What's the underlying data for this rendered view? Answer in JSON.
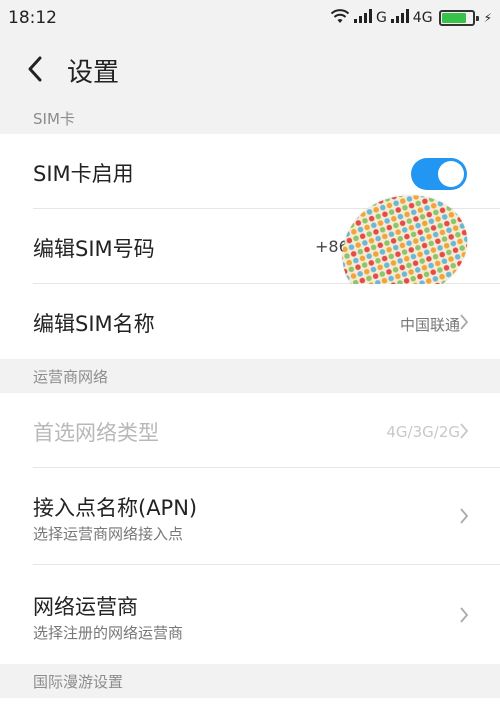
{
  "status_bar": {
    "time": "18:12",
    "network_1": "G",
    "network_2": "4G",
    "icons": [
      "wifi-icon",
      "signal-icon",
      "signal-icon",
      "battery-icon",
      "charging-icon"
    ],
    "battery_level": 0.8,
    "battery_color": "#39c24a"
  },
  "header": {
    "back_icon": "chevron-left-icon",
    "title": "设置"
  },
  "sections": {
    "sim": {
      "header": "SIM卡",
      "rows": {
        "sim_enable": {
          "label": "SIM卡启用",
          "toggle_on": true,
          "toggle_color": "#2196f3"
        },
        "edit_number": {
          "label": "编辑SIM号码",
          "value": "+86"
        },
        "edit_name": {
          "label": "编辑SIM名称",
          "value": "中国联通"
        }
      }
    },
    "carrier": {
      "header": "运营商网络",
      "rows": {
        "preferred_network": {
          "label": "首选网络类型",
          "value": "4G/3G/2G",
          "disabled": true
        },
        "apn": {
          "label": "接入点名称(APN)",
          "subtitle": "选择运营商网络接入点"
        },
        "network_operator": {
          "label": "网络运营商",
          "subtitle": "选择注册的网络运营商"
        }
      }
    },
    "roaming": {
      "header": "国际漫游设置"
    }
  }
}
